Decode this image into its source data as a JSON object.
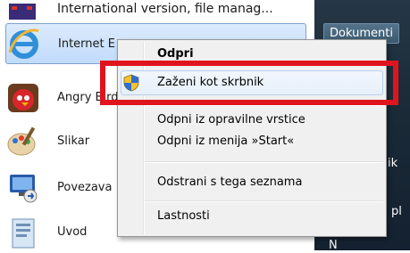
{
  "start_menu": {
    "top_item": "International version, file manag...",
    "programs": [
      {
        "label": "Internet Explorer",
        "visible_label": "Internet E",
        "icon": "internet-explorer-icon"
      },
      {
        "label": "Angry Birds",
        "visible_label": "Angry Bird",
        "icon": "angry-birds-icon"
      },
      {
        "label": "Slikar",
        "visible_label": "Slikar",
        "icon": "paint-icon"
      },
      {
        "label": "Povezava",
        "visible_label": "Povezava",
        "icon": "remote-desktop-icon"
      },
      {
        "label": "Uvod",
        "visible_label": "Uvod",
        "icon": "getting-started-icon"
      }
    ],
    "right_pane": {
      "documents": "Dokumenti",
      "partial_1": "ik",
      "partial_2": "pl",
      "partial_3": "N"
    }
  },
  "context_menu": {
    "items": {
      "open": "Odpri",
      "run_as_admin": "Zaženi kot skrbnik",
      "unpin_taskbar": "Odpni iz opravilne vrstice",
      "unpin_start": "Odpni iz menija »Start«",
      "remove_list": "Odstrani s tega seznama",
      "properties": "Lastnosti"
    }
  },
  "colors": {
    "highlight_box": "#e0141e",
    "selection": "#c1dbfc",
    "menu_bg": "#f0f0f0"
  }
}
